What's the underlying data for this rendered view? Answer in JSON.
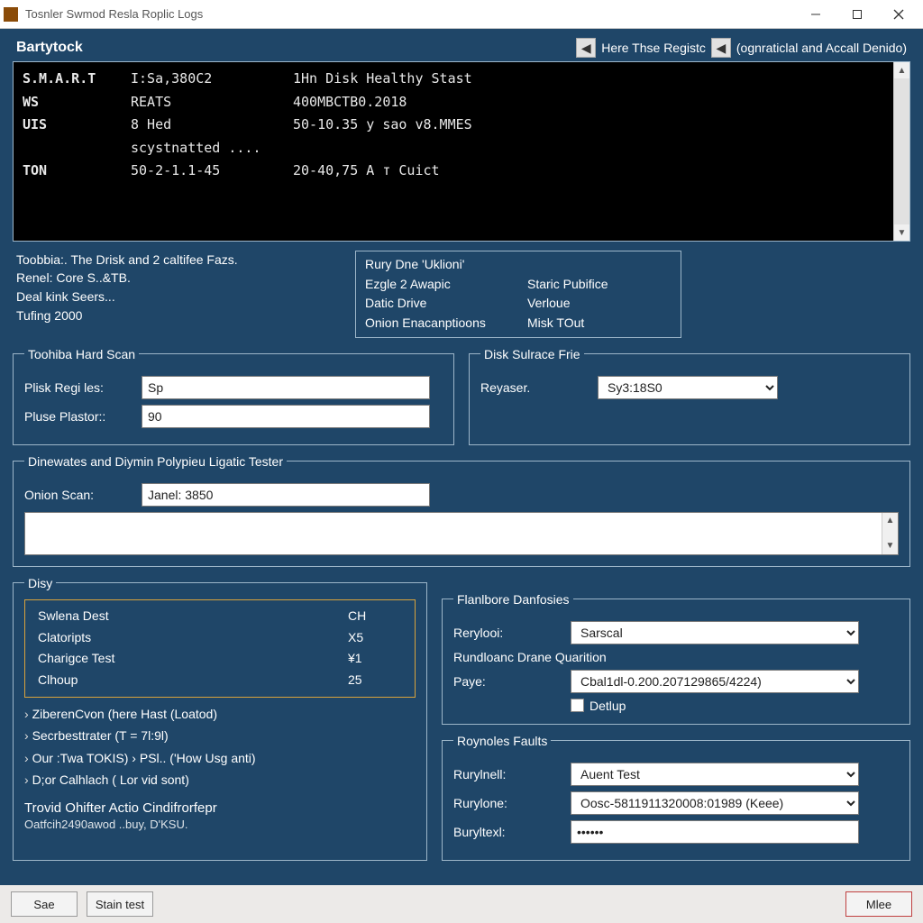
{
  "window": {
    "title": "Tosnler Swmod Resla Roplic Logs"
  },
  "log": {
    "header_label": "Bartytock",
    "nav1_label": "Here Thse Registc",
    "nav2_label": "(ognraticlal and Accall Denido)",
    "rows": [
      {
        "c1": "S.M.A.R.T",
        "c2": "I:Sa,380C2",
        "c3": "1Hn Disk Healthy Stast"
      },
      {
        "c1": "WS",
        "c2": "REATS",
        "c3": "400MBCTB0.2018"
      },
      {
        "c1": "UIS",
        "c2": "8 Hed scystnatted ....",
        "c3": "50-10.35 y sao v8.MMES"
      },
      {
        "c1": "TON",
        "c2": "50-2-1.1-45",
        "c3": "20-40,75 A т Cuict"
      }
    ]
  },
  "info_left": {
    "title": "Toobbia:. The Drisk and 2 caltifee Fazs.",
    "lines": [
      "Renel: Core S..&TB.",
      "Deal kink Seers...",
      "Tufing 2000"
    ]
  },
  "info_right": {
    "title": "Rury Dne 'Uklioni'",
    "rows": [
      [
        "Ezgle 2 Awapic",
        "Staric Pubifice"
      ],
      [
        "Datic Drive",
        "Verloue"
      ],
      [
        "Onion Enacanptioons",
        "Misk TOut"
      ]
    ]
  },
  "hard_scan": {
    "legend": "Toohiba Hard Scan",
    "field1_label": "Plisk Regi les:",
    "field1_value": "Sp",
    "field2_label": "Pluse Plastor::",
    "field2_value": "90"
  },
  "surface": {
    "legend": "Disk Sulrace Frie",
    "label": "Reyaser.",
    "value": "Sy3:18S0"
  },
  "tester": {
    "legend": "Dinewates and Diymin Polypieu Ligatic Tester",
    "label": "Onion Scan:",
    "value": "Janel: 3850"
  },
  "disy": {
    "legend": "Disy",
    "table": [
      {
        "k": "Swlena Dest",
        "v": "CH"
      },
      {
        "k": "Clatoripts",
        "v": "X5"
      },
      {
        "k": "Charigce Test",
        "v": "¥1"
      },
      {
        "k": "Clhoup",
        "v": "25"
      }
    ],
    "list": [
      "ZiberenCvon (here Hast (Loatod)",
      "Secrbesttrater (T = 7l:9l)",
      "Our :Twa TOKIS) › PSl.. ('How Usg anti)",
      "D;or Calhlach ( Lor vid sont)"
    ],
    "sub_title": "Trovid Ohifter Actio Cindifrorfepr",
    "sub_small": "Oatfcih2490awod ..buy, D'KSU."
  },
  "flanbore": {
    "legend": "Flanlbore Danfosies",
    "f1_label": "Rerylooi:",
    "f1_value": "Sarscal",
    "line2": "Rundloanc Drane Quarition",
    "f2_label": "Paye:",
    "f2_value": "Cbal1dl-0.200.207129865/4224)",
    "chk_label": "Detlup"
  },
  "roynoles": {
    "legend": "Roynoles Faults",
    "f1_label": "Rurylnell:",
    "f1_value": "Auent Test",
    "f2_label": "Rurylone:",
    "f2_value": "Oosc-5811911320008:01989 (Keee)",
    "f3_label": "Buryltexl:",
    "f3_value": "••••••"
  },
  "footer": {
    "save": "Sae",
    "stain": "Stain test",
    "mlee": "Mlee"
  }
}
